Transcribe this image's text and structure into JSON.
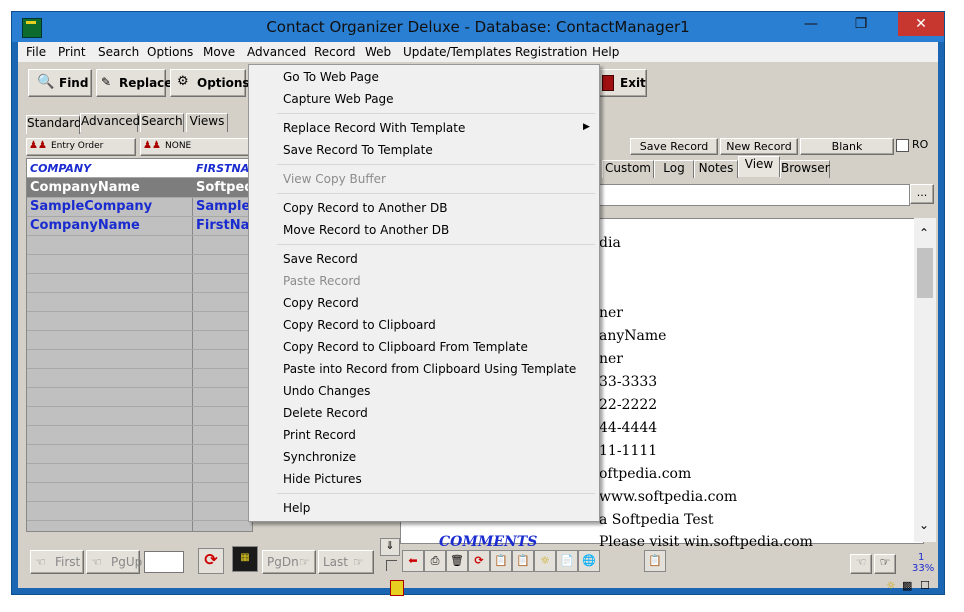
{
  "window": {
    "title": "Contact Organizer Deluxe - Database: ContactManager1",
    "min": "—",
    "max": "❐",
    "close": "✕"
  },
  "menubar": [
    "File",
    "Print",
    "Search",
    "Options",
    "Move",
    "Advanced",
    "Record",
    "Web",
    "Update/Templates",
    "Registration",
    "Help"
  ],
  "toolbar": {
    "find": "Find",
    "replace": "Replace",
    "options": "Options",
    "exit": "Exit"
  },
  "left_tabs": [
    "Standard",
    "Advanced",
    "Search",
    "Views"
  ],
  "sort": {
    "entry_order": "Entry Order",
    "none": "NONE"
  },
  "grid": {
    "headers": [
      "COMPANY",
      "FIRSTNAM"
    ],
    "rows": [
      [
        "CompanyName",
        "Softpedi"
      ],
      [
        "SampleCompany",
        "SampleF"
      ],
      [
        "CompanyName",
        "FirstNam"
      ]
    ]
  },
  "nav": {
    "first": "First",
    "pgup": "PgUp",
    "pgdn": "PgDn",
    "last": "Last"
  },
  "record_buttons": {
    "save": "Save Record",
    "new": "New Record",
    "blank": "Blank",
    "ro": "RO"
  },
  "right_tabs": [
    "Custom",
    "Log",
    "Notes",
    "View",
    "Browser"
  ],
  "ellipsis": "...",
  "record_view": {
    "values": [
      "dia",
      "",
      "",
      "ner",
      "anyName",
      "ner",
      "33-3333",
      "22-2222",
      "44-4444",
      "11-1111",
      "oftpedia.com",
      "www.softpedia.com",
      "a Softpedia Test"
    ],
    "comments_label": "COMMENTS",
    "comments_value": "Please visit win.softpedia.com"
  },
  "status": {
    "page": "1",
    "zoom": "33%"
  },
  "menu": {
    "items": [
      {
        "label": "Go To Web Page",
        "disabled": false
      },
      {
        "label": "Capture Web Page",
        "disabled": false
      },
      {
        "sep": true
      },
      {
        "label": "Replace Record With Template",
        "disabled": false,
        "submenu": true
      },
      {
        "label": "Save Record To Template",
        "disabled": false
      },
      {
        "sep": true
      },
      {
        "label": "View Copy Buffer",
        "disabled": true
      },
      {
        "sep": true
      },
      {
        "label": "Copy Record to Another DB",
        "disabled": false
      },
      {
        "label": "Move Record to Another DB",
        "disabled": false
      },
      {
        "sep": true
      },
      {
        "label": "Save Record",
        "disabled": false
      },
      {
        "label": "Paste Record",
        "disabled": true
      },
      {
        "label": "Copy Record",
        "disabled": false
      },
      {
        "label": "Copy Record to Clipboard",
        "disabled": false
      },
      {
        "label": "Copy Record to Clipboard From Template",
        "disabled": false
      },
      {
        "label": "Paste into Record from Clipboard Using Template",
        "disabled": false
      },
      {
        "label": "Undo Changes",
        "disabled": false
      },
      {
        "label": "Delete Record",
        "disabled": false
      },
      {
        "label": "Print Record",
        "disabled": false
      },
      {
        "label": "Synchronize",
        "disabled": false
      },
      {
        "label": "Hide Pictures",
        "disabled": false
      },
      {
        "sep": true
      },
      {
        "label": "Help",
        "disabled": false
      }
    ]
  }
}
